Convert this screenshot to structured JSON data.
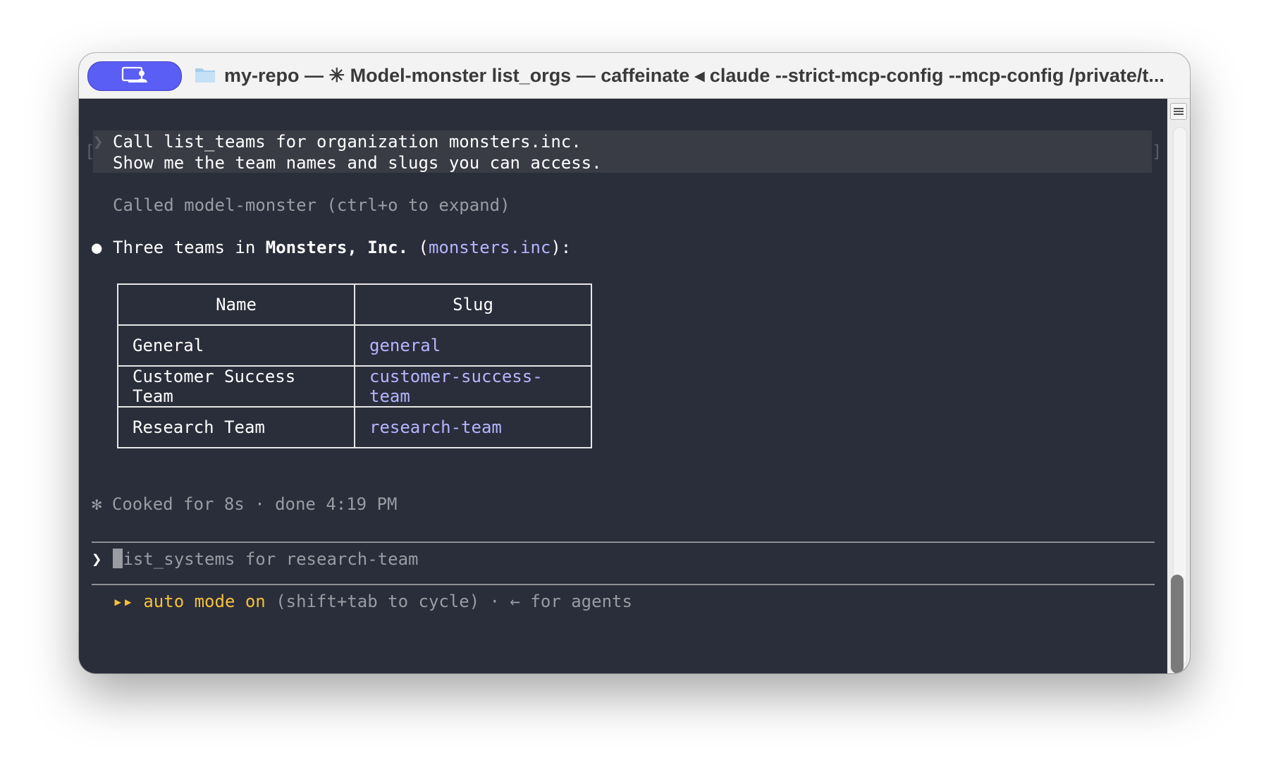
{
  "titlebar": {
    "title": "my-repo — ✳ Model-monster list_orgs — caffeinate ◂ claude --strict-mcp-config --mcp-config /private/t...",
    "profile_icon": "person-screen-icon",
    "folder_icon": "folder-icon"
  },
  "conversation": {
    "user_prompt_line1": "Call list_teams for organization monsters.inc.",
    "user_prompt_line2": "Show me the team names and slugs you can access.",
    "tool_call": "Called model-monster (ctrl+o to expand)",
    "response_prefix": "Three teams in ",
    "response_org": "Monsters, Inc.",
    "response_open": " (",
    "response_slug": "monsters.inc",
    "response_close": "):",
    "table": {
      "headers": [
        "Name",
        "Slug"
      ],
      "rows": [
        {
          "name": "General",
          "slug": "general"
        },
        {
          "name": "Customer Success Team",
          "slug": "customer-success-team"
        },
        {
          "name": "Research Team",
          "slug": "research-team"
        }
      ]
    },
    "status": "✻ Cooked for 8s · done 4:19 PM"
  },
  "input": {
    "prompt_symbol": "❯",
    "placeholder_first": "l",
    "placeholder_rest": "ist_systems for research-team"
  },
  "footer": {
    "mode_arrows": "▸▸",
    "mode_label": "auto mode on",
    "hint": " (shift+tab to cycle) · ← for agents"
  },
  "colors": {
    "terminal_bg": "#2a2d3a",
    "accent_purple": "#b4b6ff",
    "mode_yellow": "#f5c13a",
    "pill_blue": "#5b5ef4"
  }
}
